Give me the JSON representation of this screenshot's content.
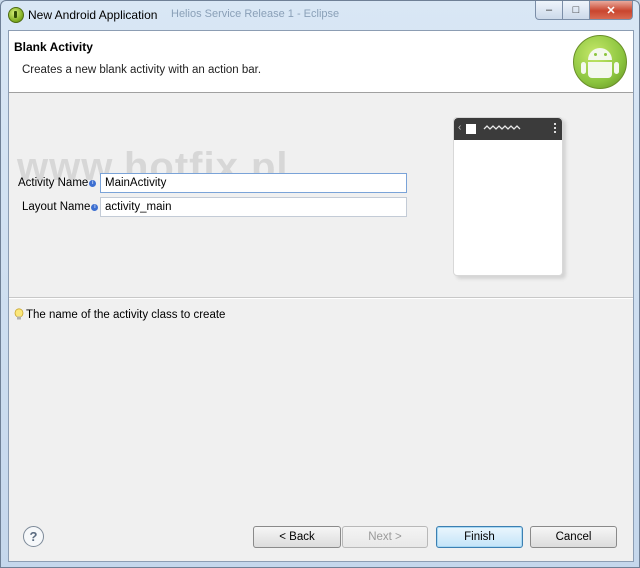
{
  "window": {
    "title": "New Android Application",
    "ghost_title": "Helios Service Release 1 - Eclipse",
    "controls": {
      "minimize": "–",
      "maximize": "□",
      "close": "✕"
    },
    "app_icon": "android-adt-icon"
  },
  "header": {
    "title": "Blank Activity",
    "description": "Creates a new blank activity with an action bar.",
    "logo_icon": "android-robot-logo"
  },
  "watermark": "www.hotfix.pl",
  "form": {
    "activity_name": {
      "label": "Activity Name",
      "value": "MainActivity",
      "info_icon": "i"
    },
    "layout_name": {
      "label": "Layout Name",
      "value": "activity_main",
      "info_icon": "i"
    }
  },
  "preview": {
    "chevron": "‹"
  },
  "hint": {
    "text": "The name of the activity class to create",
    "icon": "lightbulb-icon"
  },
  "footer": {
    "help_label": "?",
    "back_label": "< Back",
    "next_label": "Next >",
    "finish_label": "Finish",
    "cancel_label": "Cancel"
  },
  "colors": {
    "title_bar": "#d9e7f5",
    "close_button": "#c9452e",
    "android_green": "#8cc53f",
    "default_button": "#3c7fb1"
  }
}
